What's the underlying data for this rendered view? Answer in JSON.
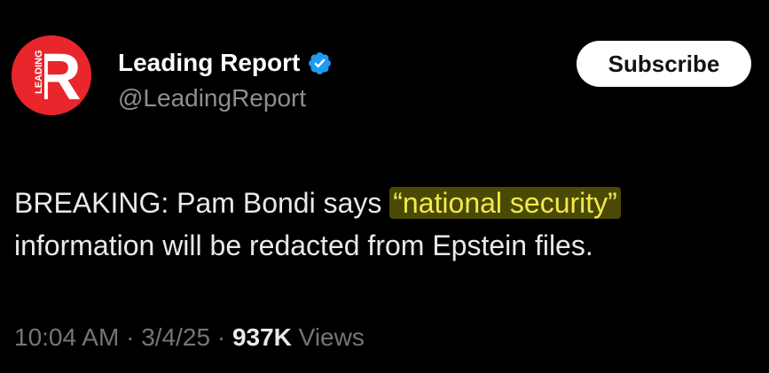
{
  "account": {
    "display_name": "Leading Report",
    "handle": "@LeadingReport",
    "verified": true,
    "avatar_letter": "R",
    "avatar_side_text": "LEADING",
    "avatar_color": "#e8262b",
    "verified_color": "#1d9bf0"
  },
  "subscribe_label": "Subscribe",
  "tweet": {
    "line1_prefix": "BREAKING:  Pam Bondi says ",
    "highlight": "“national security”",
    "line2": "information will be redacted from Epstein files.",
    "highlight_color": "#f1ea4a"
  },
  "meta": {
    "time": "10:04 AM",
    "sep1": " · ",
    "date": "3/4/25",
    "sep2": " · ",
    "views_count": "937K",
    "views_label": " Views"
  }
}
